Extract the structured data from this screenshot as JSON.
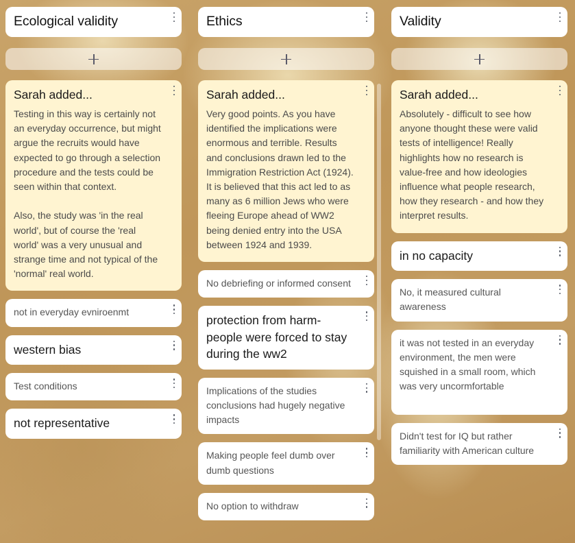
{
  "columns": [
    {
      "title": "Ecological validity",
      "add_label": "+",
      "note": {
        "title": "Sarah added...",
        "body": "Testing in this way is certainly not an everyday occurrence, but might argue the recruits would have expected to go through a selection procedure and the tests could be seen within that context.\n\nAlso, the study was 'in the real world', but of course the 'real world' was a very unusual and strange time and not typical of the 'normal' real world."
      },
      "cards": [
        {
          "text": "not in everyday evniroenmt",
          "bold": false
        },
        {
          "text": "western bias",
          "bold": true
        },
        {
          "text": "Test conditions",
          "bold": false
        },
        {
          "text": "not representative",
          "bold": true
        }
      ]
    },
    {
      "title": "Ethics",
      "add_label": "+",
      "note": {
        "title": "Sarah added...",
        "body": "Very good points. As you have identified the implications were enormous and terrible. Results and conclusions drawn led to the Immigration Restriction Act (1924). It is believed that this act led to as many as 6 million Jews who were fleeing Europe ahead of WW2 being denied entry into the USA between 1924 and 1939."
      },
      "cards": [
        {
          "text": "No debriefing or informed consent",
          "bold": false
        },
        {
          "text": "protection from harm- people were forced to stay during the ww2",
          "bold": true
        },
        {
          "text": "Implications of the studies conclusions had hugely negative impacts",
          "bold": false
        },
        {
          "text": "Making people feel dumb over dumb questions",
          "bold": false
        },
        {
          "text": "No option to withdraw",
          "bold": false
        }
      ]
    },
    {
      "title": "Validity",
      "add_label": "+",
      "note": {
        "title": "Sarah added...",
        "body": "Absolutely - difficult to see how anyone thought these were valid tests of intelligence! Really highlights how no research is value-free and how ideologies influence what people research, how they research - and how they interpret results."
      },
      "cards": [
        {
          "text": "in no capacity",
          "bold": true
        },
        {
          "text": "No, it measured cultural awareness",
          "bold": false
        },
        {
          "text": "it was not tested in an everyday environment, the men were squished in a small room, which was very uncormfortable",
          "bold": false
        },
        {
          "text": "Didn't test for IQ but rather familiarity with American culture",
          "bold": false
        }
      ]
    }
  ],
  "icons": {
    "add": "plus-icon",
    "menu": "more-vertical-icon"
  },
  "colors": {
    "note_background": "#fff4d1",
    "card_background": "#ffffff",
    "board_background": "#c39c62"
  }
}
